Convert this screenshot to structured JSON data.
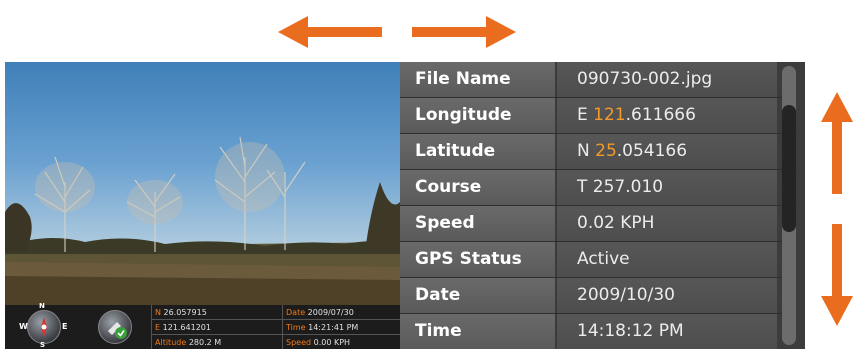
{
  "info": {
    "rows": [
      {
        "label": "File Name",
        "value": "090730-002.jpg"
      },
      {
        "label": "Longitude",
        "value_prefix": "E ",
        "value_highlight": "121",
        "value_suffix": ".611666"
      },
      {
        "label": "Latitude",
        "value_prefix": "N ",
        "value_highlight": "25",
        "value_suffix": ".054166"
      },
      {
        "label": "Course",
        "value": "T 257.010"
      },
      {
        "label": "Speed",
        "value": "0.02 KPH"
      },
      {
        "label": "GPS Status",
        "value": "Active"
      },
      {
        "label": "Date",
        "value": "2009/10/30"
      },
      {
        "label": "Time",
        "value": "14:18:12 PM"
      }
    ]
  },
  "gps_overlay": {
    "lat_key": "N",
    "lat": "26.057915",
    "lon_key": "E",
    "lon": "121.641201",
    "alt_key": "Altitude",
    "alt": "280.2 M",
    "date_key": "Date",
    "date": "2009/07/30",
    "time_key": "Time",
    "time": "14:21:41 PM",
    "speed_key": "Speed",
    "speed": "0.00 KPH",
    "compass_letters": {
      "n": "N",
      "w": "W",
      "e": "E",
      "s": "S"
    }
  },
  "colors": {
    "accent": "#f07a1a",
    "highlight": "#f39a2a",
    "label_bg": "#5f5f5f",
    "value_bg": "#525252"
  },
  "icons": [
    "arrow-left-icon",
    "arrow-right-icon",
    "arrow-up-icon",
    "arrow-down-icon",
    "compass-icon",
    "gps-satellite-icon"
  ]
}
